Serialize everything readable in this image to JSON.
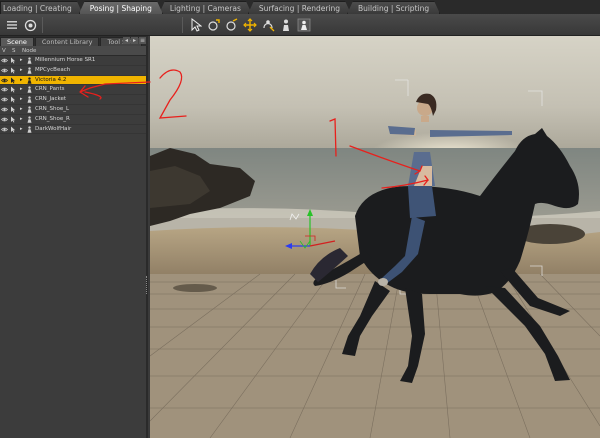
{
  "rooms": {
    "tabs": [
      {
        "label": "Loading | Creating",
        "active": false
      },
      {
        "label": "Posing | Shaping",
        "active": true
      },
      {
        "label": "Lighting | Cameras",
        "active": false
      },
      {
        "label": "Surfacing | Rendering",
        "active": false
      },
      {
        "label": "Building | Scripting",
        "active": false
      }
    ]
  },
  "toolbar": {
    "icons": [
      "menu-icon",
      "camera-icon",
      "select-arrow-icon",
      "rotate-tool-icon",
      "twist-tool-icon",
      "translate-tool-icon",
      "universal-tool-icon",
      "figure-tool-icon"
    ]
  },
  "scene_pane": {
    "tabs": [
      {
        "label": "Scene",
        "active": true
      },
      {
        "label": "Content Library",
        "active": false
      },
      {
        "label": "Tool Sett",
        "active": false
      }
    ],
    "columns": {
      "v": "V",
      "s": "S",
      "node": "Node"
    },
    "nodes": [
      {
        "label": "Millennium Horse SR1",
        "selected": false
      },
      {
        "label": "MPCycBeach",
        "selected": false
      },
      {
        "label": "Victoria 4.2",
        "selected": true
      },
      {
        "label": "CRN_Pants",
        "selected": false
      },
      {
        "label": "CRN_Jacket",
        "selected": false
      },
      {
        "label": "CRN_Shoe_L",
        "selected": false
      },
      {
        "label": "CRN_Shoe_R",
        "selected": false
      },
      {
        "label": "DarkWolfHair",
        "selected": false
      }
    ]
  },
  "annotations": {
    "number_one": "1",
    "number_two": "2",
    "color": "#e8201c"
  },
  "colors": {
    "selected_row": "#f0b400",
    "accent_toolbar": "#f0b400"
  }
}
